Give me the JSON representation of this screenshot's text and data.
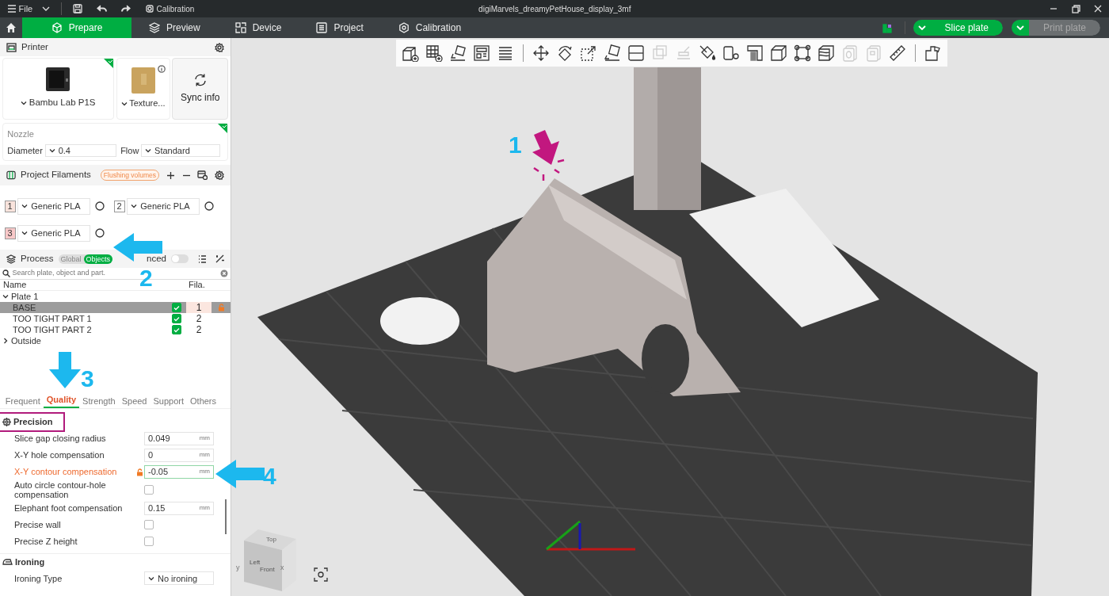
{
  "title_bar": {
    "menu": "File",
    "breadcrumb": "Calibration",
    "title": "digiMarvels_dreamyPetHouse_display_3mf"
  },
  "tabs": [
    {
      "label": "Prepare",
      "selected": true
    },
    {
      "label": "Preview",
      "selected": false
    },
    {
      "label": "Device",
      "selected": false
    },
    {
      "label": "Project",
      "selected": false
    },
    {
      "label": "Calibration",
      "selected": false
    }
  ],
  "actions": [
    {
      "label": "Slice plate",
      "disabled": false
    },
    {
      "label": "Print plate",
      "disabled": true
    }
  ],
  "printer": {
    "title": "Printer",
    "model": "Bambu Lab P1S",
    "plate": "Texture...",
    "sync": "Sync info",
    "nozzle_title": "Nozzle",
    "diameter_label": "Diameter",
    "diameter": "0.4",
    "flow_label": "Flow",
    "flow": "Standard"
  },
  "filaments": {
    "title": "Project Filaments",
    "badge": "Flushing volumes",
    "items": [
      {
        "number": "1",
        "name": "Generic PLA",
        "color": "#f9e3dc"
      },
      {
        "number": "2",
        "name": "Generic PLA",
        "color": "#ffffff"
      },
      {
        "number": "3",
        "name": "Generic PLA",
        "color": "#f8c8c8"
      }
    ]
  },
  "process": {
    "title": "Process",
    "modes": [
      {
        "label": "Global",
        "selected": false
      },
      {
        "label": "Objects",
        "selected": true
      }
    ],
    "advanced_label": "nced",
    "advanced_on": false,
    "search_placeholder": "Search plate, object and part.",
    "columns": [
      "Name",
      "Fila."
    ],
    "tree": [
      {
        "name": "Plate 1",
        "expanded": true,
        "children": [
          {
            "name": "BASE",
            "selected": true,
            "visible": true,
            "filament": "1",
            "locked": true
          },
          {
            "name": "TOO TIGHT PART 1",
            "selected": false,
            "visible": true,
            "filament": "2",
            "locked": false
          },
          {
            "name": "TOO TIGHT PART 2",
            "selected": false,
            "visible": true,
            "filament": "2",
            "locked": false
          }
        ]
      },
      {
        "name": "Outside",
        "expanded": false
      }
    ]
  },
  "settings_tabs": [
    {
      "label": "Frequent",
      "selected": false
    },
    {
      "label": "Quality",
      "selected": true
    },
    {
      "label": "Strength",
      "selected": false
    },
    {
      "label": "Speed",
      "selected": false
    },
    {
      "label": "Support",
      "selected": false
    },
    {
      "label": "Others",
      "selected": false
    }
  ],
  "sections": [
    {
      "title": "Precision",
      "highlighted": true,
      "rows": [
        {
          "kind": "number",
          "label": "Slice gap closing radius",
          "value": "0.049",
          "unit": "mm",
          "modified": false
        },
        {
          "kind": "number",
          "label": "X-Y hole compensation",
          "value": "0",
          "unit": "mm",
          "modified": false
        },
        {
          "kind": "number",
          "label": "X-Y contour compensation",
          "value": "-0.05",
          "unit": "mm",
          "modified": true
        },
        {
          "kind": "checkbox",
          "label": "Auto circle contour-hole compensation",
          "checked": false
        },
        {
          "kind": "number",
          "label": "Elephant foot compensation",
          "value": "0.15",
          "unit": "mm",
          "modified": false
        },
        {
          "kind": "checkbox",
          "label": "Precise wall",
          "checked": false
        },
        {
          "kind": "checkbox",
          "label": "Precise Z height",
          "checked": false
        }
      ]
    },
    {
      "title": "Ironing",
      "highlighted": false,
      "rows": [
        {
          "kind": "select",
          "label": "Ironing Type",
          "value": "No ironing"
        }
      ]
    }
  ],
  "toolbar": [
    [
      {
        "disabled": false
      },
      {
        "disabled": false
      },
      {
        "disabled": false
      },
      {
        "disabled": false
      },
      {
        "disabled": false
      }
    ],
    [
      {
        "disabled": false
      },
      {
        "disabled": false
      },
      {
        "disabled": false
      },
      {
        "disabled": false
      },
      {
        "disabled": false
      },
      {
        "disabled": true
      },
      {
        "disabled": true
      },
      {
        "disabled": false
      },
      {
        "disabled": false
      },
      {
        "disabled": false
      },
      {
        "disabled": false
      },
      {
        "disabled": false
      },
      {
        "disabled": false
      },
      {
        "disabled": true
      },
      {
        "disabled": true
      },
      {
        "disabled": false
      }
    ],
    [
      {
        "disabled": false
      }
    ]
  ],
  "viewport": {
    "kind": "picture",
    "view_cube": {
      "top": "Top",
      "left": "Left",
      "front": "Front"
    },
    "axes": [
      "y",
      "x"
    ]
  },
  "annotations": [
    {
      "label": "1",
      "color": "#c2177f"
    },
    {
      "label": "2",
      "color": "#1cb8ee"
    },
    {
      "label": "3",
      "color": "#1cb8ee"
    },
    {
      "label": "4",
      "color": "#1cb8ee"
    }
  ]
}
